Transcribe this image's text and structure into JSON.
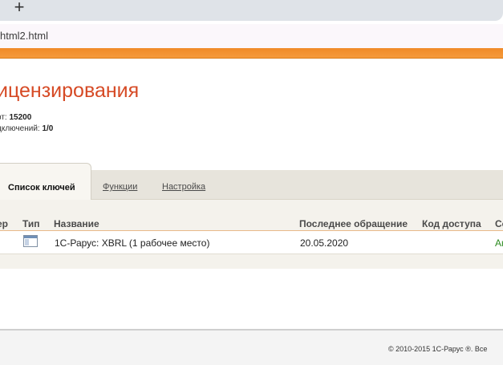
{
  "browser": {
    "new_tab_symbol": "+",
    "url": "html2.html"
  },
  "page": {
    "title": "ицензирования",
    "info": [
      {
        "label": "рт: ",
        "value": "15200"
      },
      {
        "label": "дключений: ",
        "value": "1/0"
      }
    ]
  },
  "tabs": [
    {
      "label": "Список ключей",
      "active": true
    },
    {
      "label": "Функции",
      "active": false
    },
    {
      "label": "Настройка",
      "active": false
    }
  ],
  "table": {
    "columns": [
      "ер",
      "Тип",
      "Название",
      "Последнее обращение",
      "Код доступа",
      "Се"
    ],
    "rows": [
      {
        "type_icon": "window-icon",
        "name": "1С-Рарус: XBRL (1 рабочее место)",
        "last_access": "20.05.2020",
        "access_code": "",
        "status": "Ак"
      }
    ]
  },
  "footer": {
    "copyright": "© 2010-2015 1С-Рарус ®. Все"
  },
  "colors": {
    "title": "#d64a25",
    "accent_bar": "#f08a27",
    "status_active": "#2b8a1f"
  }
}
